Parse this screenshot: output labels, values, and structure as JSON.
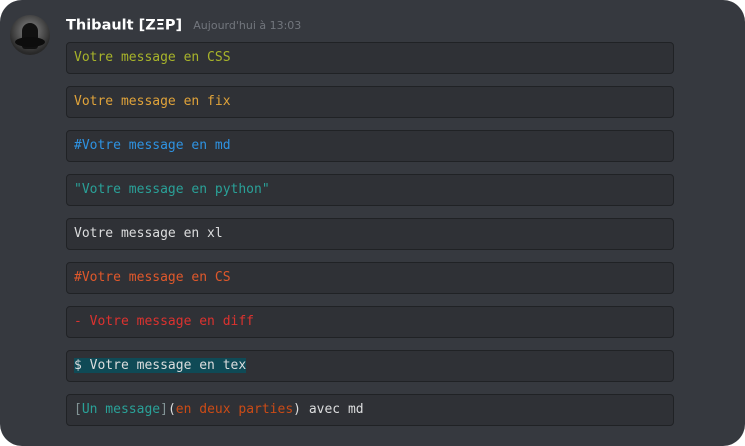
{
  "message": {
    "username": "Thibault [ZΞP]",
    "timestamp": "Aujourd'hui à 13:03"
  },
  "blocks": {
    "css": "Votre message en CSS",
    "fix": "Votre message en fix",
    "md": "#Votre message en md",
    "python": "\"Votre message en python\"",
    "xl": "Votre message en xl",
    "cs": "#Votre message en CS",
    "diff": "- Votre message en diff",
    "tex": "$ Votre message en tex",
    "md2": {
      "open_bracket": "[",
      "link_text": "Un message",
      "close_bracket": "]",
      "open_paren": "(",
      "url_text": "en deux parties",
      "close_paren": ")",
      "rest": " avec md"
    }
  },
  "colors": {
    "background": "#36393f",
    "code_background": "#2f3136",
    "css": "#a8b42a",
    "fix": "#e0a33a",
    "md": "#2e93e3",
    "python": "#2aa198",
    "cs": "#e0582b",
    "diff": "#dc322f",
    "tex_highlight": "#0f4a56"
  }
}
